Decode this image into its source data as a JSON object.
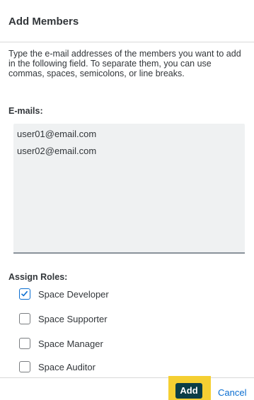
{
  "dialog": {
    "title": "Add Members",
    "description": "Type the e-mail addresses of the members you want to add in the following field. To separate them, you can use commas, spaces, semicolons, or line breaks.",
    "emails_label": "E-mails:",
    "emails": [
      "user01@email.com",
      "user02@email.com"
    ],
    "roles_label": "Assign Roles:",
    "roles": [
      {
        "label": "Space Developer",
        "checked": true
      },
      {
        "label": "Space Supporter",
        "checked": false
      },
      {
        "label": "Space Manager",
        "checked": false
      },
      {
        "label": "Space Auditor",
        "checked": false
      }
    ],
    "footer": {
      "add_label": "Add",
      "cancel_label": "Cancel"
    }
  },
  "colors": {
    "accent": "#0a6ed1",
    "primary_button": "#0b3e46",
    "focus_highlight": "#f5cf32",
    "input_background": "#eff1f2"
  }
}
